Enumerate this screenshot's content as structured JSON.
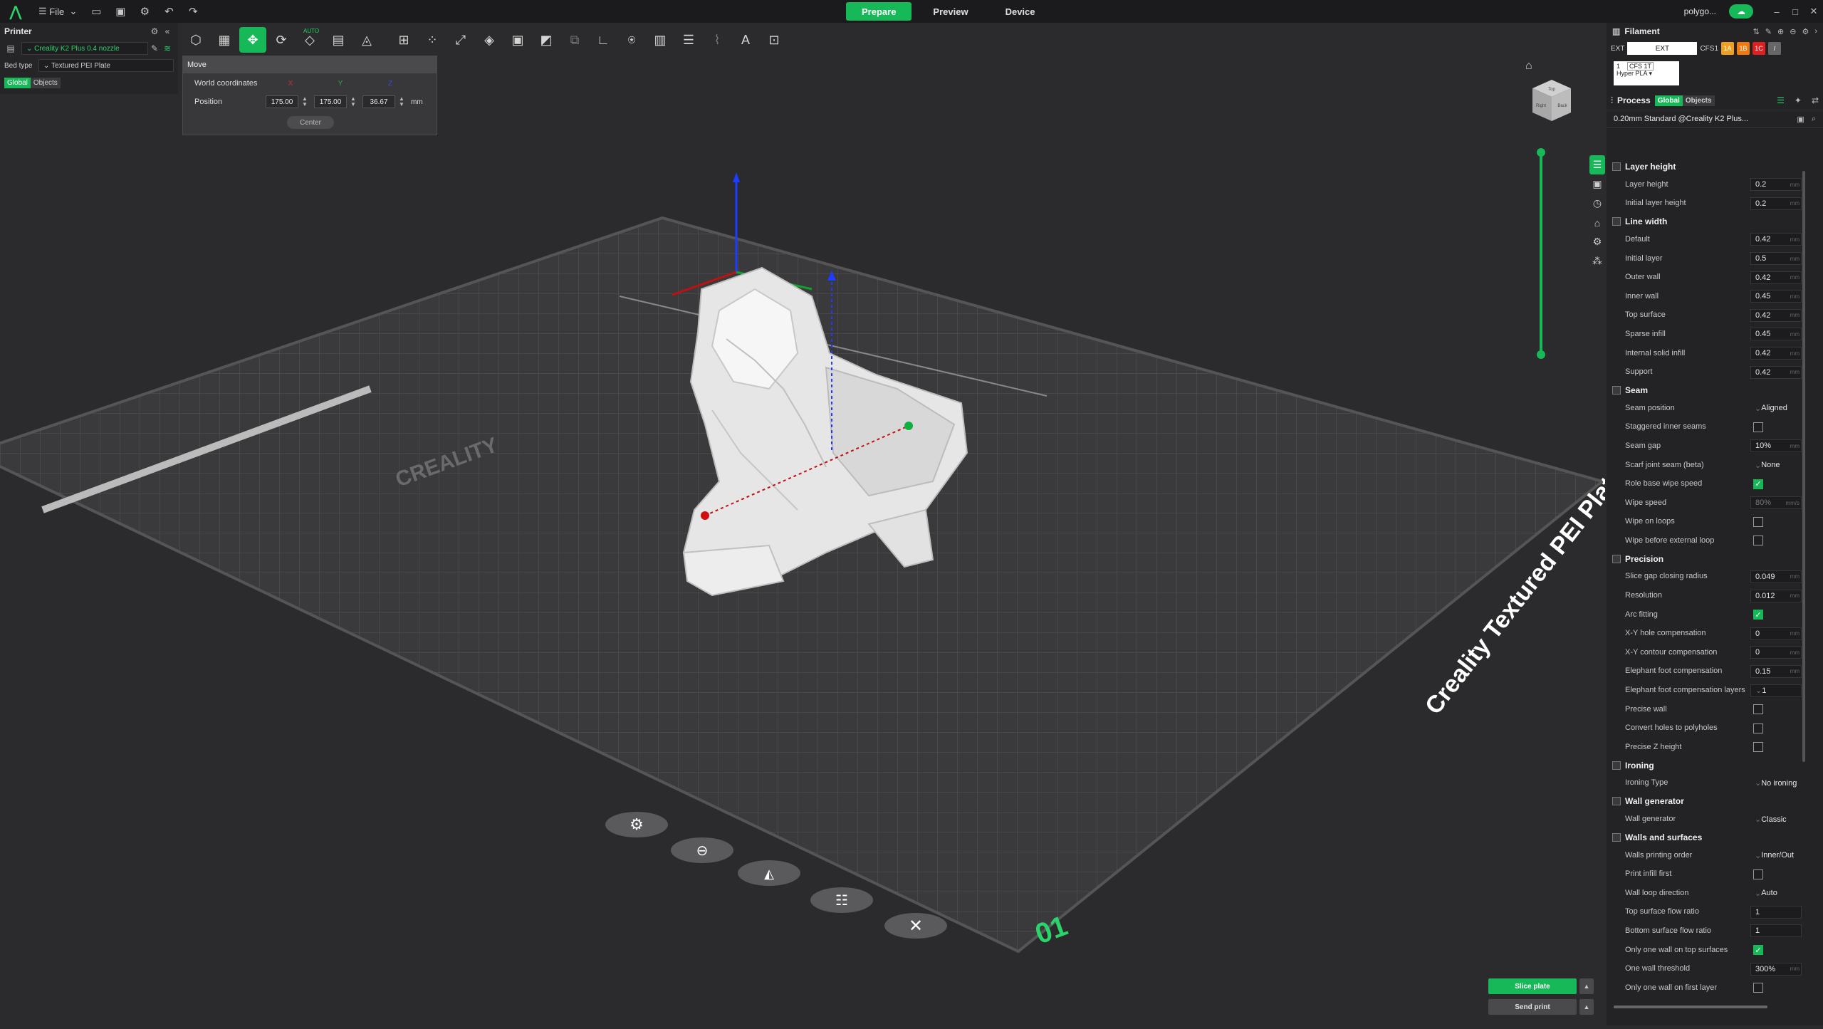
{
  "titlebar": {
    "file_label": "File",
    "tabs": [
      "Prepare",
      "Preview",
      "Device"
    ],
    "user": "polygo..."
  },
  "printer_panel": {
    "title": "Printer",
    "printer_name": "Creality K2 Plus 0.4 nozzle",
    "bed_label": "Bed type",
    "bed_value": "Textured PEI Plate",
    "seg_global": "Global",
    "seg_objects": "Objects"
  },
  "move_panel": {
    "title": "Move",
    "world_label": "World coordinates",
    "axes": [
      "X",
      "Y",
      "Z"
    ],
    "position_label": "Position",
    "x": "175.00",
    "y": "175.00",
    "z": "36.67",
    "unit": "mm",
    "center_label": "Center"
  },
  "viewport": {
    "plate_text": "Creality Textured PEI Plate",
    "brand_text": "CREALITY",
    "plate_number": "01",
    "navcube_labels": [
      "Top",
      "Right",
      "Back"
    ]
  },
  "filament": {
    "title": "Filament",
    "ext_label": "EXT",
    "ext_value": "EXT",
    "cfs_label": "CFS1",
    "chips": [
      {
        "label": "1A",
        "color": "#f0a020"
      },
      {
        "label": "1B",
        "color": "#f07a10"
      },
      {
        "label": "1C",
        "color": "#e02020"
      },
      {
        "label": "/",
        "color": "#666666"
      }
    ],
    "card_slot": "1",
    "card_cfs": "CFS 1T",
    "card_type": "Hyper PLA"
  },
  "process": {
    "title": "Process",
    "seg_global": "Global",
    "seg_objects": "Objects",
    "preset": "0.20mm Standard @Creality K2 Plus...",
    "sections": [
      {
        "title": "Layer height",
        "options": [
          {
            "label": "Layer height",
            "value": "0.2",
            "unit": "mm"
          },
          {
            "label": "Initial layer height",
            "value": "0.2",
            "unit": "mm"
          }
        ]
      },
      {
        "title": "Line width",
        "options": [
          {
            "label": "Default",
            "value": "0.42",
            "unit": "mm"
          },
          {
            "label": "Initial layer",
            "value": "0.5",
            "unit": "mm"
          },
          {
            "label": "Outer wall",
            "value": "0.42",
            "unit": "mm"
          },
          {
            "label": "Inner wall",
            "value": "0.45",
            "unit": "mm"
          },
          {
            "label": "Top surface",
            "value": "0.42",
            "unit": "mm"
          },
          {
            "label": "Sparse infill",
            "value": "0.45",
            "unit": "mm"
          },
          {
            "label": "Internal solid infill",
            "value": "0.42",
            "unit": "mm"
          },
          {
            "label": "Support",
            "value": "0.42",
            "unit": "mm"
          }
        ]
      },
      {
        "title": "Seam",
        "options": [
          {
            "label": "Seam position",
            "value": "Aligned",
            "kind": "select"
          },
          {
            "label": "Staggered inner seams",
            "check": false
          },
          {
            "label": "Seam gap",
            "value": "10%",
            "unit": "mm"
          },
          {
            "label": "Scarf joint seam (beta)",
            "value": "None",
            "kind": "select"
          },
          {
            "label": "Role base wipe speed",
            "check": true
          },
          {
            "label": "Wipe speed",
            "value": "80%",
            "unit": "mm/s",
            "dim": true
          },
          {
            "label": "Wipe on loops",
            "check": false
          },
          {
            "label": "Wipe before external loop",
            "check": false
          }
        ]
      },
      {
        "title": "Precision",
        "options": [
          {
            "label": "Slice gap closing radius",
            "value": "0.049",
            "unit": "mm"
          },
          {
            "label": "Resolution",
            "value": "0.012",
            "unit": "mm"
          },
          {
            "label": "Arc fitting",
            "check": true
          },
          {
            "label": "X-Y hole compensation",
            "value": "0",
            "unit": "mm"
          },
          {
            "label": "X-Y contour compensation",
            "value": "0",
            "unit": "mm"
          },
          {
            "label": "Elephant foot compensation",
            "value": "0.15",
            "unit": "mm"
          },
          {
            "label": "Elephant foot compensation layers",
            "value": "1",
            "kind": "spin"
          },
          {
            "label": "Precise wall",
            "check": false
          },
          {
            "label": "Convert holes to polyholes",
            "check": false
          },
          {
            "label": "Precise Z height",
            "check": false
          }
        ]
      },
      {
        "title": "Ironing",
        "options": [
          {
            "label": "Ironing Type",
            "value": "No ironing",
            "kind": "select"
          }
        ]
      },
      {
        "title": "Wall generator",
        "options": [
          {
            "label": "Wall generator",
            "value": "Classic",
            "kind": "select"
          }
        ]
      },
      {
        "title": "Walls and surfaces",
        "options": [
          {
            "label": "Walls printing order",
            "value": "Inner/Out",
            "kind": "select"
          },
          {
            "label": "Print infill first",
            "check": false
          },
          {
            "label": "Wall loop direction",
            "value": "Auto",
            "kind": "select"
          },
          {
            "label": "Top surface flow ratio",
            "value": "1"
          },
          {
            "label": "Bottom surface flow ratio",
            "value": "1"
          },
          {
            "label": "Only one wall on top surfaces",
            "check": true
          },
          {
            "label": "One wall threshold",
            "value": "300%",
            "unit": "mm"
          },
          {
            "label": "Only one wall on first layer",
            "check": false
          }
        ]
      }
    ]
  },
  "actions": {
    "slice": "Slice plate",
    "send": "Send print"
  }
}
